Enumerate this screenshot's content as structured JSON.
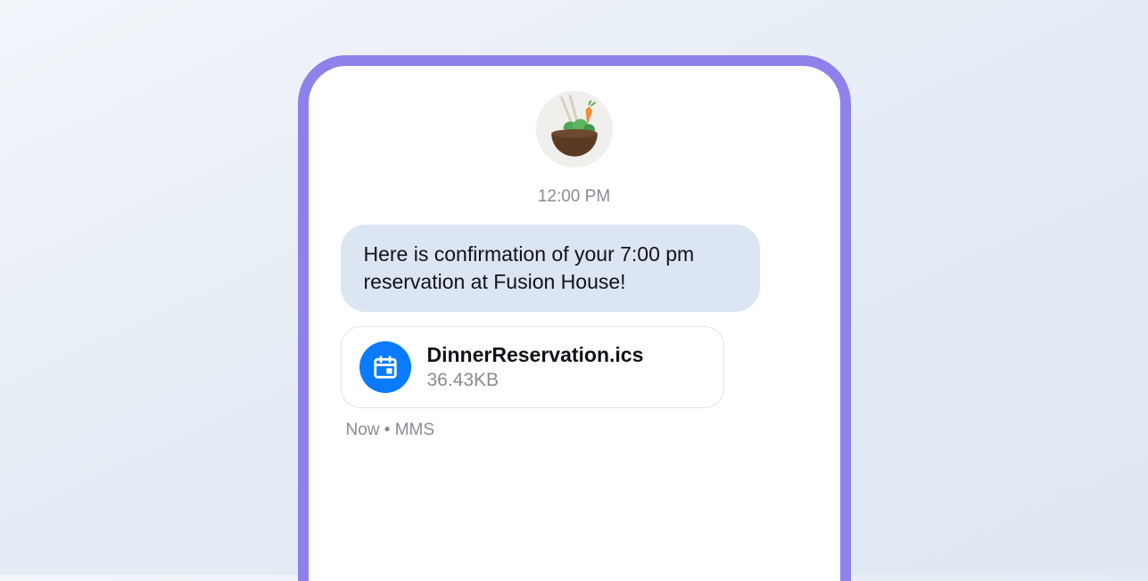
{
  "conversation": {
    "avatar_alt": "bowl-food-icon",
    "timestamp": "12:00 PM",
    "message": "Here is confirmation of your 7:00 pm reservation at Fusion House!",
    "attachment": {
      "icon": "calendar-icon",
      "filename": "DinnerReservation.ics",
      "size": "36.43KB"
    },
    "meta": "Now • MMS"
  }
}
